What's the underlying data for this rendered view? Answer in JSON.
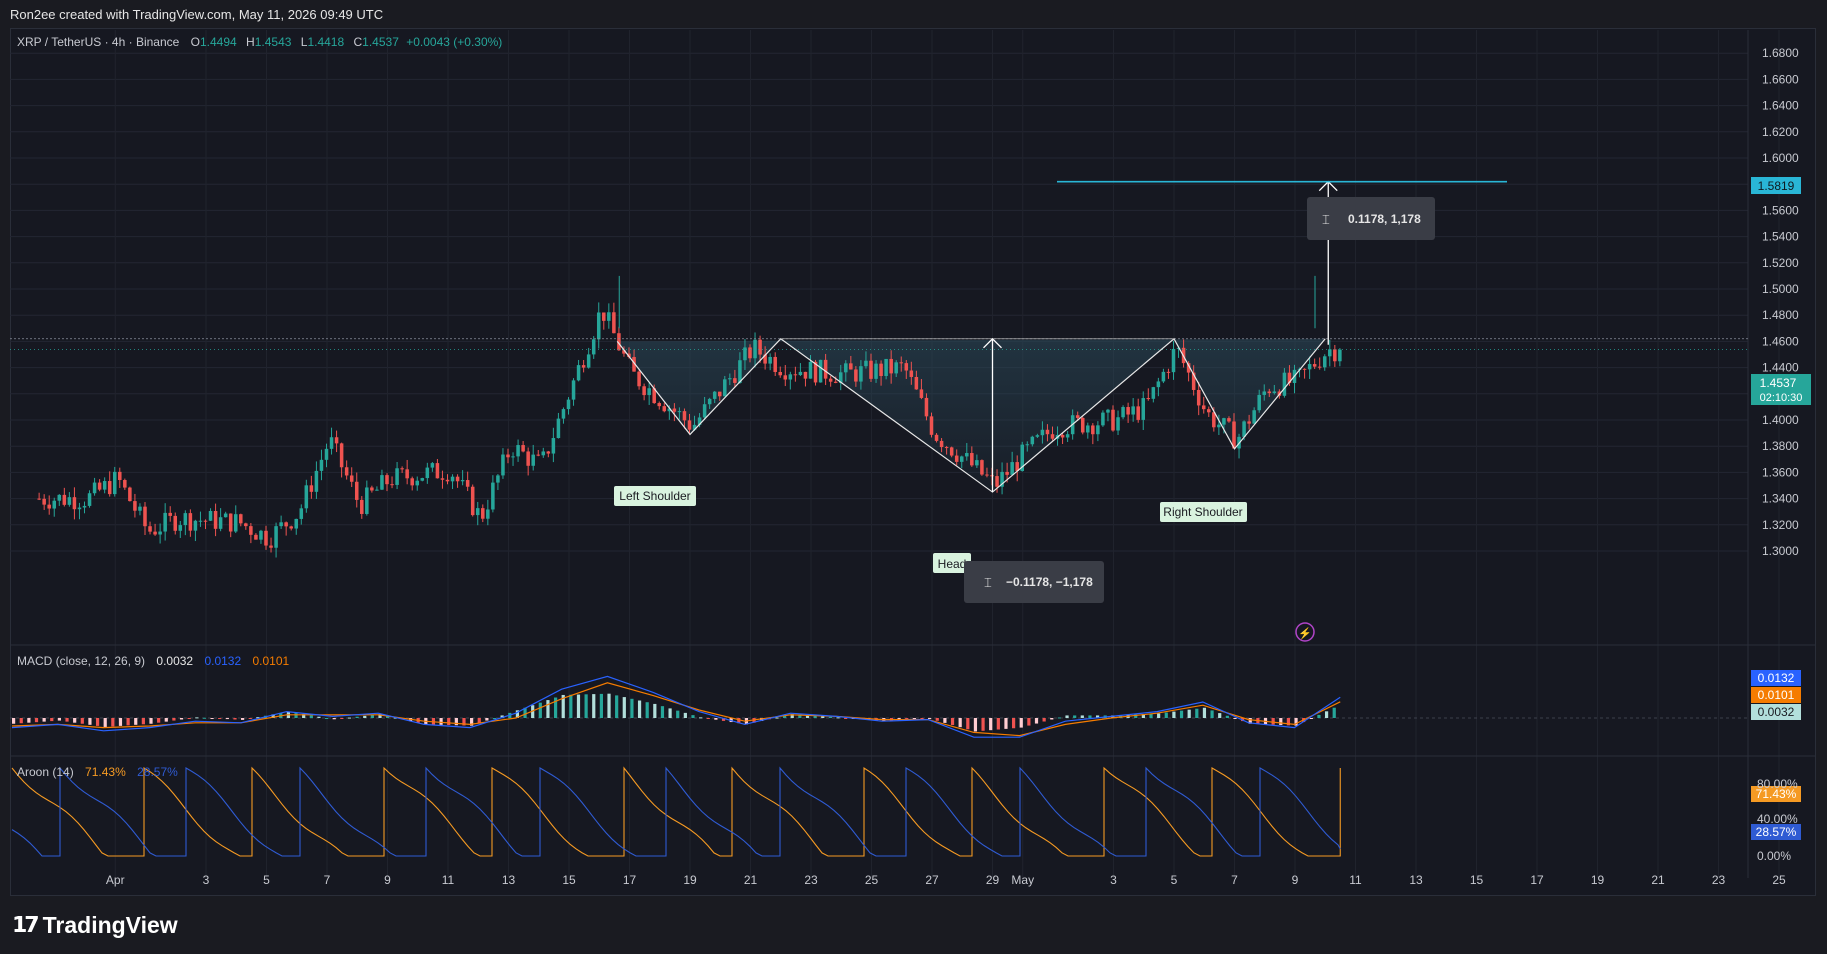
{
  "header": {
    "attribution": "Ron2ee created with TradingView.com, May 11, 2026 09:49 UTC"
  },
  "legend": {
    "symbol": "XRP / TetherUS · 4h · Binance",
    "o_label": "O",
    "o": "1.4494",
    "h_label": "H",
    "h": "1.4543",
    "l_label": "L",
    "l": "1.4418",
    "c_label": "C",
    "c": "1.4537",
    "change": "+0.0043 (+0.30%)"
  },
  "macd_legend": {
    "name": "MACD (close, 12, 26, 9)",
    "hist": "0.0032",
    "macd": "0.0132",
    "signal": "0.0101"
  },
  "aroon_legend": {
    "name": "Aroon (14)",
    "up": "71.43%",
    "down": "28.57%"
  },
  "annotations": {
    "left_shoulder": "Left Shoulder",
    "head": "Head",
    "right_shoulder": "Right Shoulder",
    "measure_down": "−0.1178, −1,178",
    "measure_up": "0.1178, 1,178"
  },
  "price_labels": {
    "target": "1.5819",
    "last": "1.4537",
    "countdown": "02:10:30"
  },
  "macd_labels": {
    "macd": "0.0132",
    "signal": "0.0101",
    "hist": "0.0032"
  },
  "aroon_labels": {
    "up": "71.43%",
    "down": "28.57%",
    "top_tick": "80.00%",
    "mid_tick": "40.00%",
    "bottom_tick": "0.00%"
  },
  "footer": {
    "brand": "TradingView"
  },
  "colors": {
    "bull": "#26a69a",
    "bear": "#ef5350",
    "macd": "#2962ff",
    "signal": "#f57c00",
    "aroon_up": "#f59a23",
    "aroon_down": "#2f5bd3",
    "target_line": "#29b6d6",
    "background": "#161821"
  },
  "chart_data": [
    {
      "type": "candlestick",
      "title": "XRP / TetherUS · 4h · Binance",
      "y_ticks": [
        "1.3000",
        "1.3200",
        "1.3400",
        "1.3600",
        "1.3800",
        "1.4000",
        "1.4200",
        "1.4400",
        "1.4600",
        "1.4800",
        "1.5000",
        "1.5200",
        "1.5400",
        "1.5600",
        "1.5800",
        "1.6000",
        "1.6200",
        "1.6400",
        "1.6600",
        "1.6800"
      ],
      "x_ticks": [
        "Apr",
        "3",
        "5",
        "7",
        "9",
        "11",
        "13",
        "15",
        "17",
        "19",
        "21",
        "23",
        "25",
        "27",
        "29",
        "May",
        "3",
        "5",
        "7",
        "9",
        "11",
        "13",
        "15",
        "17",
        "19",
        "21",
        "23",
        "25"
      ],
      "ylim": [
        1.285,
        1.69
      ],
      "x_start": "2026-03-31",
      "pattern": "inverse head and shoulders",
      "pattern_points": [
        {
          "label": "Left Shoulder",
          "date": "2026-04-20",
          "price": 1.389
        },
        {
          "label": "Head",
          "date": "2026-04-30",
          "price": 1.345
        },
        {
          "label": "Right Shoulder",
          "date": "2026-05-08",
          "price": 1.378
        }
      ],
      "neckline": 1.462,
      "target": 1.5819,
      "measured_move": 0.1178,
      "key_closes": [
        {
          "date": "2026-03-31",
          "close": 1.34
        },
        {
          "date": "2026-04-01",
          "close": 1.355
        },
        {
          "date": "2026-04-02",
          "close": 1.315
        },
        {
          "date": "2026-04-03",
          "close": 1.325
        },
        {
          "date": "2026-04-05",
          "close": 1.322
        },
        {
          "date": "2026-04-06",
          "close": 1.31
        },
        {
          "date": "2026-04-07",
          "close": 1.33
        },
        {
          "date": "2026-04-08",
          "close": 1.385
        },
        {
          "date": "2026-04-09",
          "close": 1.335
        },
        {
          "date": "2026-04-10",
          "close": 1.355
        },
        {
          "date": "2026-04-12",
          "close": 1.362
        },
        {
          "date": "2026-04-13",
          "close": 1.325
        },
        {
          "date": "2026-04-14",
          "close": 1.38
        },
        {
          "date": "2026-04-15",
          "close": 1.365
        },
        {
          "date": "2026-04-16",
          "close": 1.425
        },
        {
          "date": "2026-04-17",
          "close": 1.485
        },
        {
          "date": "2026-04-18",
          "close": 1.435
        },
        {
          "date": "2026-04-19",
          "close": 1.415
        },
        {
          "date": "2026-04-20",
          "close": 1.395
        },
        {
          "date": "2026-04-22",
          "close": 1.455
        },
        {
          "date": "2026-04-23",
          "close": 1.44
        },
        {
          "date": "2026-04-25",
          "close": 1.435
        },
        {
          "date": "2026-04-27",
          "close": 1.44
        },
        {
          "date": "2026-04-28",
          "close": 1.39
        },
        {
          "date": "2026-04-30",
          "close": 1.35
        },
        {
          "date": "2026-05-01",
          "close": 1.375
        },
        {
          "date": "2026-05-02",
          "close": 1.395
        },
        {
          "date": "2026-05-04",
          "close": 1.4
        },
        {
          "date": "2026-05-05",
          "close": 1.41
        },
        {
          "date": "2026-05-06",
          "close": 1.455
        },
        {
          "date": "2026-05-07",
          "close": 1.405
        },
        {
          "date": "2026-05-08",
          "close": 1.385
        },
        {
          "date": "2026-05-09",
          "close": 1.425
        },
        {
          "date": "2026-05-10",
          "close": 1.43
        },
        {
          "date": "2026-05-11",
          "close": 1.4537
        }
      ]
    },
    {
      "type": "line",
      "title": "MACD (close, 12, 26, 9)",
      "series": [
        {
          "name": "MACD",
          "values": [
            -0.006,
            -0.004,
            -0.008,
            -0.006,
            -0.002,
            -0.003,
            0.004,
            0.001,
            0.003,
            -0.004,
            -0.006,
            0.003,
            0.018,
            0.026,
            0.016,
            0.004,
            -0.004,
            0.003,
            0.001,
            -0.002,
            -0.001,
            -0.012,
            -0.012,
            -0.002,
            0.001,
            0.004,
            0.01,
            -0.003,
            -0.006,
            0.013
          ]
        },
        {
          "name": "Signal",
          "values": [
            -0.005,
            -0.004,
            -0.006,
            -0.005,
            -0.003,
            -0.003,
            0.002,
            0.002,
            0.002,
            -0.002,
            -0.004,
            0.0,
            0.012,
            0.022,
            0.014,
            0.005,
            -0.002,
            0.002,
            0.001,
            -0.001,
            -0.001,
            -0.009,
            -0.011,
            -0.004,
            0.0,
            0.003,
            0.008,
            -0.001,
            -0.004,
            0.0101
          ]
        }
      ],
      "histogram_last": 0.0032
    },
    {
      "type": "line",
      "title": "Aroon (14)",
      "ylim": [
        0,
        100
      ],
      "series": [
        {
          "name": "Aroon Up",
          "last": 71.43
        },
        {
          "name": "Aroon Down",
          "last": 28.57
        }
      ]
    }
  ]
}
